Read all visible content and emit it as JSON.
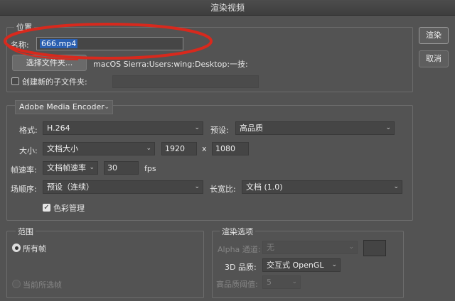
{
  "window": {
    "title": "渲染视频"
  },
  "location": {
    "group_label": "位置",
    "name_label": "名称:",
    "name_value": "666.mp4",
    "choose_folder_button": "选择文件夹...",
    "folder_path": "macOS Sierra:Users:wing:Desktop:一技:",
    "create_subfolder_label": "创建新的子文件夹:",
    "create_subfolder_checked": false,
    "subfolder_value": ""
  },
  "encoder": {
    "selected": "Adobe Media Encoder",
    "format_label": "格式:",
    "format_value": "H.264",
    "preset_label": "预设:",
    "preset_value": "高品质",
    "size_label": "大小:",
    "size_value": "文档大小",
    "width_value": "1920",
    "x_label": "x",
    "height_value": "1080",
    "framerate_label": "帧速率:",
    "framerate_mode": "文档帧速率",
    "fps_value": "30",
    "fps_unit": "fps",
    "field_order_label": "场顺序:",
    "field_order_value": "预设（连续）",
    "aspect_label": "长宽比:",
    "aspect_value": "文档 (1.0)",
    "color_mgmt_label": "色彩管理",
    "color_mgmt_checked": true
  },
  "range": {
    "group_label": "范围",
    "all_frames_label": "所有帧",
    "current_frames_label": "当前所选帧"
  },
  "render_options": {
    "group_label": "渲染选项",
    "alpha_label": "Alpha 通道:",
    "alpha_value": "无",
    "quality_3d_label": "3D 品质:",
    "quality_3d_value": "交互式 OpenGL",
    "hq_threshold_label": "高品质阈值:",
    "hq_threshold_value": "5"
  },
  "actions": {
    "render_button": "渲染",
    "cancel_button": "取消"
  },
  "annotation": {
    "color": "#d8291d"
  }
}
